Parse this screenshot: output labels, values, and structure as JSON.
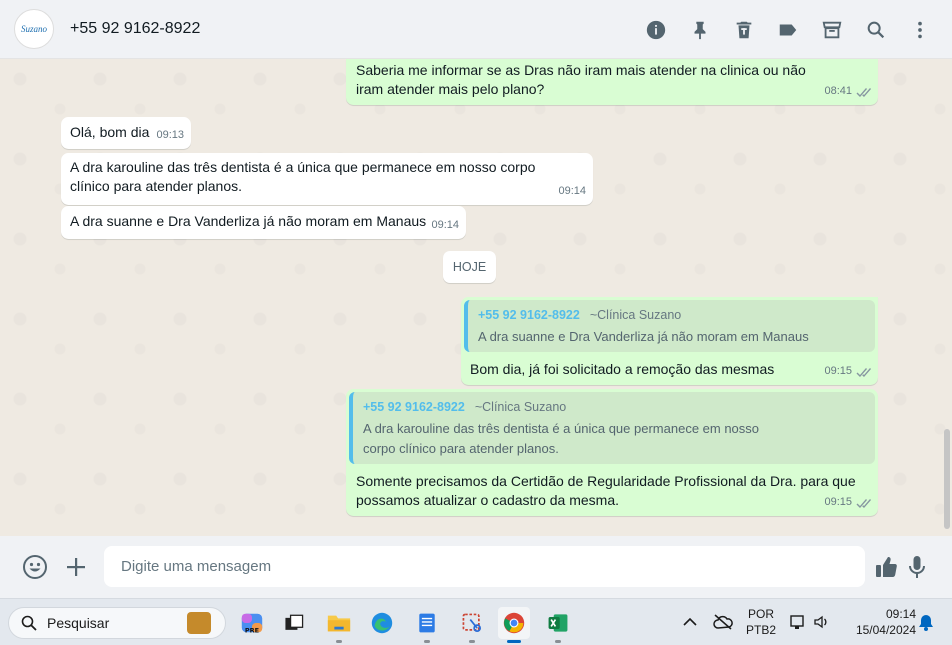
{
  "header": {
    "avatar_text": "Suzano",
    "contact_name": "+55 92 9162-8922",
    "icons": [
      "info-icon",
      "pin-icon",
      "delete-icon",
      "label-icon",
      "archive-icon",
      "search-icon",
      "menu-icon"
    ]
  },
  "messages": [
    {
      "dir": "out",
      "text": "Saberia me informar se as Dras não iram mais atender na clinica ou não iram atender mais pelo plano?",
      "time": "08:41",
      "read": true
    },
    {
      "dir": "in",
      "text": "Olá, bom dia",
      "time": "09:13"
    },
    {
      "dir": "in",
      "text": "A dra karouline das três dentista é a única que permanece em nosso corpo clínico para atender planos.",
      "time": "09:14"
    },
    {
      "dir": "in",
      "text": "A dra suanne e Dra Vanderliza já não moram em Manaus",
      "time": "09:14"
    },
    {
      "dir": "out",
      "quote": {
        "author": "+55 92 9162-8922",
        "alias": "~Clínica Suzano",
        "text": "A dra suanne e Dra Vanderliza já não moram em Manaus"
      },
      "text": "Bom dia, já foi solicitado a remoção das mesmas",
      "time": "09:15",
      "read": true
    },
    {
      "dir": "out",
      "quote": {
        "author": "+55 92 9162-8922",
        "alias": "~Clínica Suzano",
        "text": "A dra karouline das três dentista é a única que permanece em nosso corpo clínico para atender planos."
      },
      "text": "Somente precisamos da  Certidão de Regularidade Profissional da Dra. para que possamos atualizar o cadastro da mesma.",
      "time": "09:15",
      "read": true
    }
  ],
  "day_divider": "HOJE",
  "composer": {
    "placeholder": "Digite uma mensagem"
  },
  "taskbar": {
    "search_label": "Pesquisar",
    "apps": [
      "copilot-icon",
      "task-view-icon",
      "file-explorer-icon",
      "edge-icon",
      "notepad-icon",
      "snipping-tool-icon",
      "chrome-icon",
      "excel-icon"
    ],
    "lang_top": "POR",
    "lang_bottom": "PTB2",
    "time": "09:14",
    "date": "15/04/2024"
  },
  "colors": {
    "out_bubble": "#d9fdd3",
    "in_bubble": "#ffffff",
    "quote_author": "#53bdeb",
    "chat_bg": "#efeae2"
  }
}
